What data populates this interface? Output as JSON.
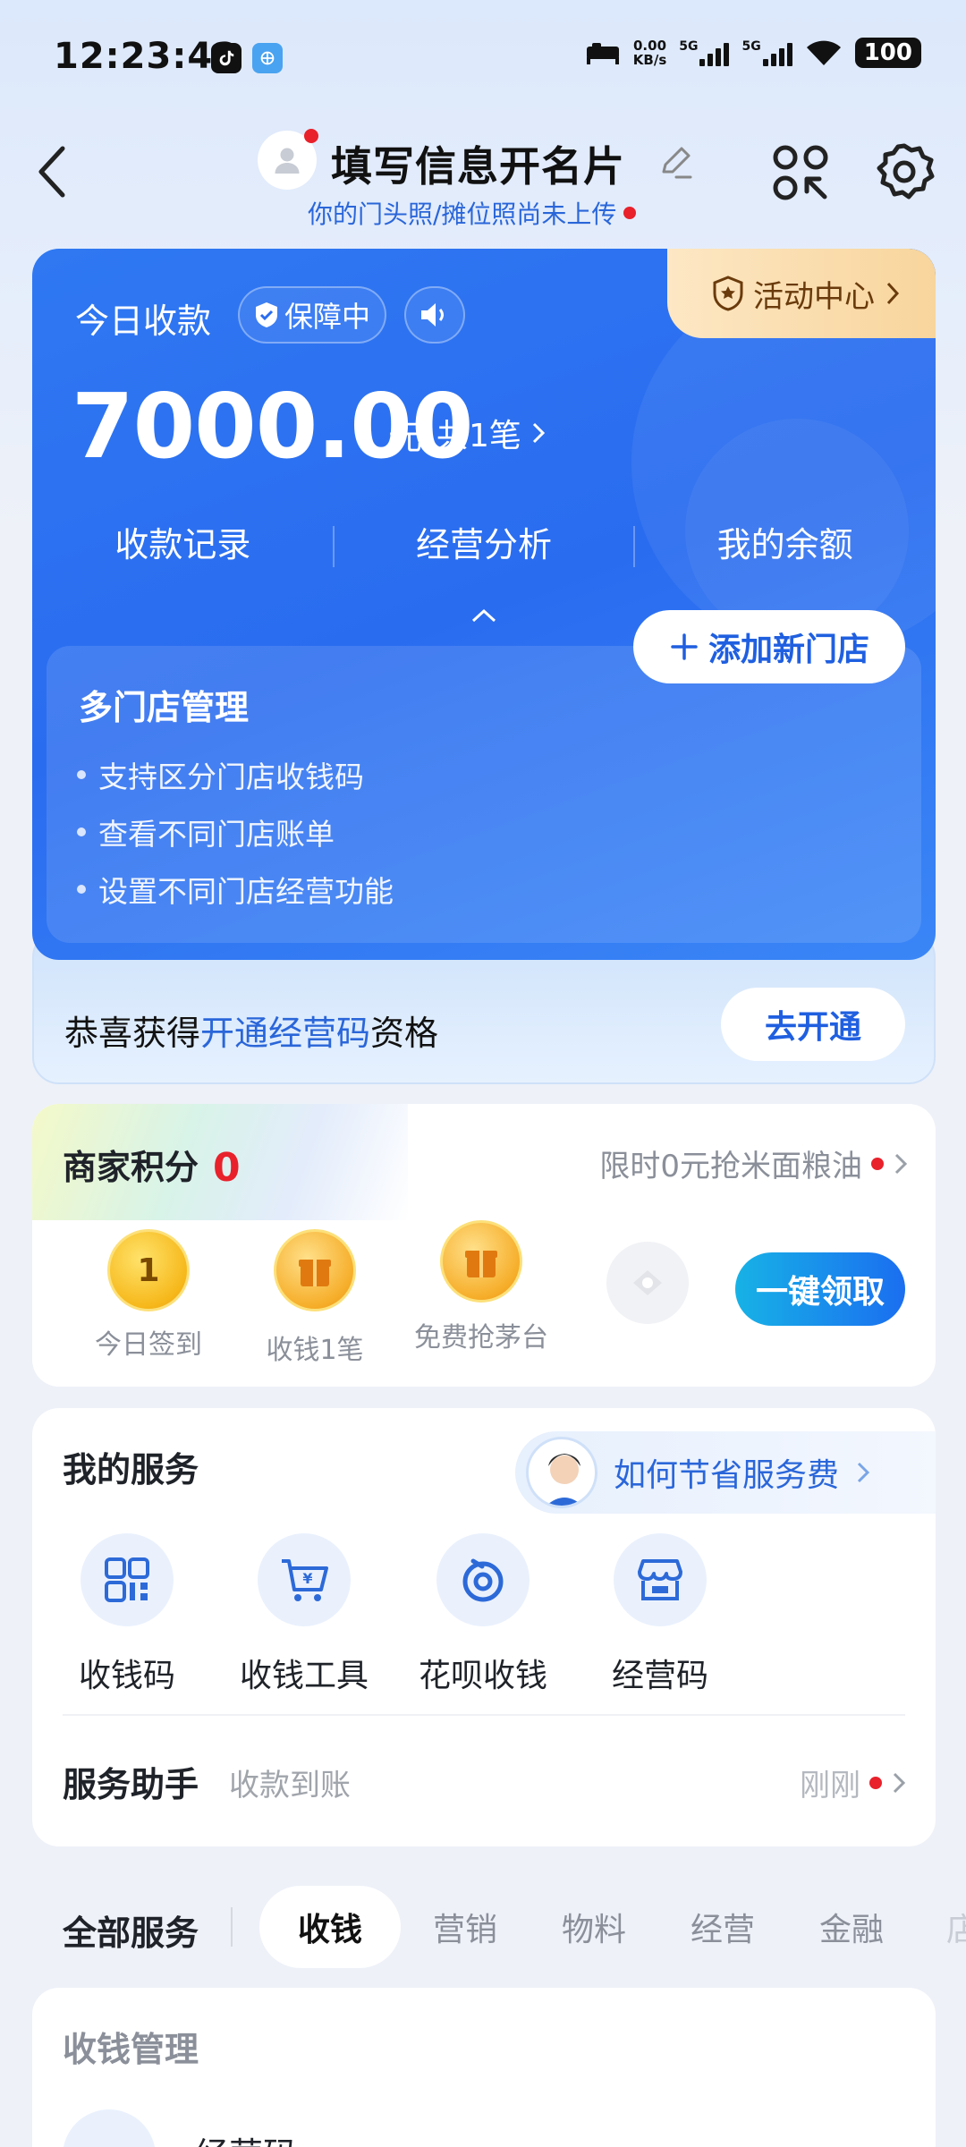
{
  "status_bar": {
    "time": "12:23:42",
    "net_speed_value": "0.00",
    "net_speed_unit": "KB/s",
    "signal1": "5G",
    "signal2": "5G",
    "battery": "100"
  },
  "header": {
    "title": "填写信息开名片",
    "subtitle": "你的门头照/摊位照尚未上传"
  },
  "income_card": {
    "activity_center": "活动中心",
    "today_label": "今日收款",
    "protect_badge": "保障中",
    "amount": "7000.00",
    "unit": "元",
    "count": "共1笔",
    "tabs": [
      "收款记录",
      "经营分析",
      "我的余额"
    ],
    "store_title": "多门店管理",
    "store_bullets": [
      "支持区分门店收钱码",
      "查看不同门店账单",
      "设置不同门店经营功能"
    ],
    "add_store_button": "添加新门店"
  },
  "open_strip": {
    "prefix": "恭喜获得",
    "highlight": "开通经营码",
    "suffix": "资格",
    "button": "去开通"
  },
  "points": {
    "title": "商家积分",
    "value": "0",
    "promo": "限时0元抢米面粮油",
    "coin1_text": "1",
    "items": [
      "今日签到",
      "收钱1笔",
      "免费抢茅台"
    ],
    "claim_button": "一键领取"
  },
  "services": {
    "title": "我的服务",
    "fee_tip": "如何节省服务费",
    "items": [
      "收钱码",
      "收钱工具",
      "花呗收钱",
      "经营码"
    ],
    "helper_title": "服务助手",
    "helper_sub": "收款到账",
    "helper_time": "刚刚"
  },
  "categories": {
    "all": "全部服务",
    "active": "收钱",
    "tabs": [
      "营销",
      "物料",
      "经营",
      "金融",
      "店"
    ]
  },
  "management": {
    "title": "收钱管理",
    "first_item": "经营码"
  },
  "colors": {
    "brand_blue": "#2a6cf0",
    "accent_red": "#e8212b",
    "link_blue": "#2a66d9"
  }
}
